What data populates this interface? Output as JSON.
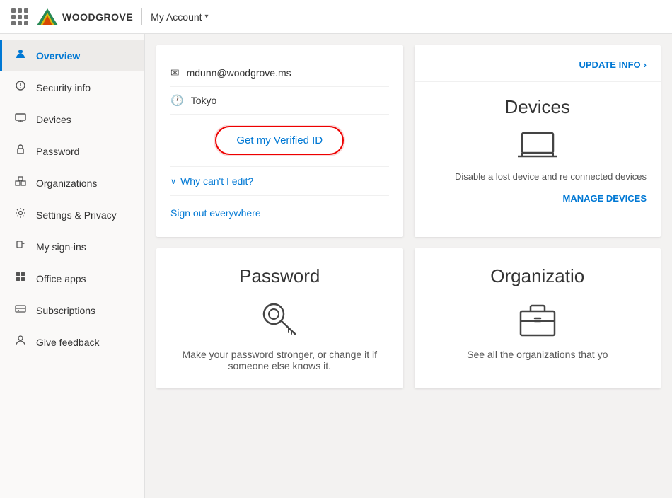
{
  "topbar": {
    "grid_icon_label": "apps",
    "logo_text": "WOODGROVE",
    "divider": "|",
    "account_label": "My Account",
    "account_arrow": "▾"
  },
  "sidebar": {
    "items": [
      {
        "id": "overview",
        "label": "Overview",
        "icon": "👤",
        "active": true
      },
      {
        "id": "security-info",
        "label": "Security info",
        "icon": "🔗"
      },
      {
        "id": "devices",
        "label": "Devices",
        "icon": "💻"
      },
      {
        "id": "password",
        "label": "Password",
        "icon": "🔑"
      },
      {
        "id": "organizations",
        "label": "Organizations",
        "icon": "🏢"
      },
      {
        "id": "settings-privacy",
        "label": "Settings & Privacy",
        "icon": "⚙"
      },
      {
        "id": "my-sign-ins",
        "label": "My sign-ins",
        "icon": "🔒"
      },
      {
        "id": "office-apps",
        "label": "Office apps",
        "icon": "📱"
      },
      {
        "id": "subscriptions",
        "label": "Subscriptions",
        "icon": "💳"
      },
      {
        "id": "give-feedback",
        "label": "Give feedback",
        "icon": "👤"
      }
    ]
  },
  "account_card": {
    "email": "mdunn@woodgrove.ms",
    "location": "Tokyo",
    "verified_id_btn": "Get my Verified ID",
    "why_cant_edit_label": "Why can't I edit?",
    "sign_out_label": "Sign out everywhere"
  },
  "devices_card": {
    "update_info_label": "UPDATE INFO",
    "update_info_arrow": "›",
    "title": "Devices",
    "description": "Disable a lost device and re connected devices",
    "manage_label": "MANAGE DEVICES"
  },
  "password_card": {
    "title": "Password",
    "description": "Make your password stronger, or change it if someone else knows it."
  },
  "organizations_card": {
    "title": "Organizatio",
    "description": "See all the organizations that yo"
  }
}
